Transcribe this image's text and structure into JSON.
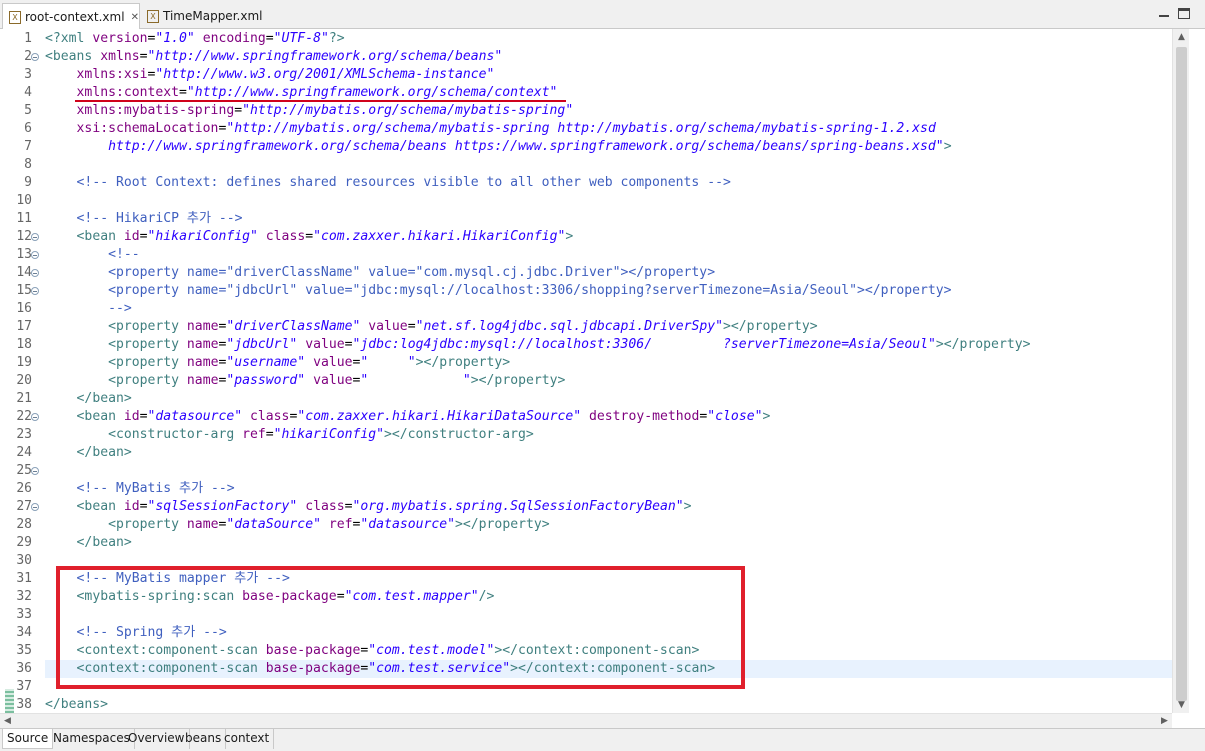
{
  "tabs": [
    {
      "label": "root-context.xml",
      "icon": "xml-file-icon",
      "active": true
    },
    {
      "label": "TimeMapper.xml",
      "icon": "xml-file-icon",
      "active": false
    }
  ],
  "lines": [
    [
      [
        "t",
        "<?xml "
      ],
      [
        "a",
        "version"
      ],
      [
        "",
        "="
      ],
      [
        "v",
        "\"1.0\""
      ],
      [
        "a",
        " encoding"
      ],
      [
        "",
        "="
      ],
      [
        "v",
        "\"UTF-8\""
      ],
      [
        "t",
        "?>"
      ]
    ],
    [
      [
        "t",
        "<beans "
      ],
      [
        "a",
        "xmlns"
      ],
      [
        "",
        "="
      ],
      [
        "v",
        "\"http://www.springframework.org/schema/beans\""
      ]
    ],
    [
      [
        "",
        "    "
      ],
      [
        "a",
        "xmlns:xsi"
      ],
      [
        "",
        "="
      ],
      [
        "v",
        "\"http://www.w3.org/2001/XMLSchema-instance\""
      ]
    ],
    [
      [
        "",
        "    "
      ],
      [
        "a",
        "xmlns:context"
      ],
      [
        "",
        "="
      ],
      [
        "v",
        "\"http://www.springframework.org/schema/context\""
      ]
    ],
    [
      [
        "",
        "    "
      ],
      [
        "a",
        "xmlns:mybatis-spring"
      ],
      [
        "",
        "="
      ],
      [
        "v",
        "\"http://mybatis.org/schema/mybatis-spring\""
      ]
    ],
    [
      [
        "",
        "    "
      ],
      [
        "a",
        "xsi:schemaLocation"
      ],
      [
        "",
        "="
      ],
      [
        "v",
        "\"http://mybatis.org/schema/mybatis-spring http://mybatis.org/schema/mybatis-spring-1.2.xsd"
      ]
    ],
    [
      [
        "v",
        "        http://www.springframework.org/schema/beans https://www.springframework.org/schema/beans/spring-beans.xsd\""
      ],
      [
        "t",
        ">"
      ]
    ],
    [],
    [
      [
        "",
        "    "
      ],
      [
        "c",
        "<!-- Root Context: defines shared resources visible to all other web components -->"
      ]
    ],
    [],
    [
      [
        "",
        "    "
      ],
      [
        "c",
        "<!-- HikariCP 추가 -->"
      ]
    ],
    [
      [
        "",
        "    "
      ],
      [
        "t",
        "<bean "
      ],
      [
        "a",
        "id"
      ],
      [
        "",
        "="
      ],
      [
        "v",
        "\"hikariConfig\""
      ],
      [
        "a",
        " class"
      ],
      [
        "",
        "="
      ],
      [
        "v",
        "\"com.zaxxer.hikari.HikariConfig\""
      ],
      [
        "t",
        ">"
      ]
    ],
    [
      [
        "",
        "        "
      ],
      [
        "c",
        "<!--"
      ]
    ],
    [
      [
        "",
        "        "
      ],
      [
        "c",
        "<property name=\"driverClassName\" value=\"com.mysql.cj.jdbc.Driver\"></property>"
      ]
    ],
    [
      [
        "",
        "        "
      ],
      [
        "c",
        "<property name=\"jdbcUrl\" value=\"jdbc:mysql://localhost:3306/shopping?serverTimezone=Asia/Seoul\"></property>"
      ]
    ],
    [
      [
        "",
        "        "
      ],
      [
        "c",
        "-->"
      ]
    ],
    [
      [
        "",
        "        "
      ],
      [
        "t",
        "<property "
      ],
      [
        "a",
        "name"
      ],
      [
        "",
        "="
      ],
      [
        "v",
        "\"driverClassName\""
      ],
      [
        "a",
        " value"
      ],
      [
        "",
        "="
      ],
      [
        "v",
        "\"net.sf.log4jdbc.sql.jdbcapi.DriverSpy\""
      ],
      [
        "t",
        "></property>"
      ]
    ],
    [
      [
        "",
        "        "
      ],
      [
        "t",
        "<property "
      ],
      [
        "a",
        "name"
      ],
      [
        "",
        "="
      ],
      [
        "v",
        "\"jdbcUrl\""
      ],
      [
        "a",
        " value"
      ],
      [
        "",
        "="
      ],
      [
        "v",
        "\"jdbc:log4jdbc:mysql://localhost:3306/         ?serverTimezone=Asia/Seoul\""
      ],
      [
        "t",
        "></property>"
      ]
    ],
    [
      [
        "",
        "        "
      ],
      [
        "t",
        "<property "
      ],
      [
        "a",
        "name"
      ],
      [
        "",
        "="
      ],
      [
        "v",
        "\"username\""
      ],
      [
        "a",
        " value"
      ],
      [
        "",
        "="
      ],
      [
        "v",
        "\"     \""
      ],
      [
        "t",
        "></property>"
      ]
    ],
    [
      [
        "",
        "        "
      ],
      [
        "t",
        "<property "
      ],
      [
        "a",
        "name"
      ],
      [
        "",
        "="
      ],
      [
        "v",
        "\"password\""
      ],
      [
        "a",
        " value"
      ],
      [
        "",
        "="
      ],
      [
        "v",
        "\"            \""
      ],
      [
        "t",
        "></property>"
      ]
    ],
    [
      [
        "",
        "    "
      ],
      [
        "t",
        "</bean>"
      ]
    ],
    [
      [
        "",
        "    "
      ],
      [
        "t",
        "<bean "
      ],
      [
        "a",
        "id"
      ],
      [
        "",
        "="
      ],
      [
        "v",
        "\"datasource\""
      ],
      [
        "a",
        " class"
      ],
      [
        "",
        "="
      ],
      [
        "v",
        "\"com.zaxxer.hikari.HikariDataSource\""
      ],
      [
        "a",
        " destroy-method"
      ],
      [
        "",
        "="
      ],
      [
        "v",
        "\"close\""
      ],
      [
        "t",
        ">"
      ]
    ],
    [
      [
        "",
        "        "
      ],
      [
        "t",
        "<constructor-arg "
      ],
      [
        "a",
        "ref"
      ],
      [
        "",
        "="
      ],
      [
        "v",
        "\"hikariConfig\""
      ],
      [
        "t",
        "></constructor-arg>"
      ]
    ],
    [
      [
        "",
        "    "
      ],
      [
        "t",
        "</bean>"
      ]
    ],
    [],
    [
      [
        "",
        "    "
      ],
      [
        "c",
        "<!-- MyBatis 추가 -->"
      ]
    ],
    [
      [
        "",
        "    "
      ],
      [
        "t",
        "<bean "
      ],
      [
        "a",
        "id"
      ],
      [
        "",
        "="
      ],
      [
        "v",
        "\"sqlSessionFactory\""
      ],
      [
        "a",
        " class"
      ],
      [
        "",
        "="
      ],
      [
        "v",
        "\"org.mybatis.spring.SqlSessionFactoryBean\""
      ],
      [
        "t",
        ">"
      ]
    ],
    [
      [
        "",
        "        "
      ],
      [
        "t",
        "<property "
      ],
      [
        "a",
        "name"
      ],
      [
        "",
        "="
      ],
      [
        "v",
        "\"dataSource\""
      ],
      [
        "a",
        " ref"
      ],
      [
        "",
        "="
      ],
      [
        "v",
        "\"datasource\""
      ],
      [
        "t",
        "></property>"
      ]
    ],
    [
      [
        "",
        "    "
      ],
      [
        "t",
        "</bean>"
      ]
    ],
    [],
    [
      [
        "",
        "    "
      ],
      [
        "c",
        "<!-- MyBatis mapper 추가 -->"
      ]
    ],
    [
      [
        "",
        "    "
      ],
      [
        "t",
        "<mybatis-spring:scan "
      ],
      [
        "a",
        "base-package"
      ],
      [
        "",
        "="
      ],
      [
        "v",
        "\"com.test.mapper\""
      ],
      [
        "t",
        "/>"
      ]
    ],
    [],
    [
      [
        "",
        "    "
      ],
      [
        "c",
        "<!-- Spring 추가 -->"
      ]
    ],
    [
      [
        "",
        "    "
      ],
      [
        "t",
        "<context:component-scan "
      ],
      [
        "a",
        "base-package"
      ],
      [
        "",
        "="
      ],
      [
        "v",
        "\"com.test.model\""
      ],
      [
        "t",
        "></context:component-scan>"
      ]
    ],
    [
      [
        "",
        "    "
      ],
      [
        "t",
        "<context:component-scan "
      ],
      [
        "a",
        "base-package"
      ],
      [
        "",
        "="
      ],
      [
        "v",
        "\"com.test.service\""
      ],
      [
        "t",
        "></context:component-scan>"
      ]
    ],
    [],
    [
      [
        "t",
        "</beans>"
      ]
    ]
  ],
  "fold_lines": [
    2,
    12,
    13,
    14,
    15,
    22,
    25,
    27
  ],
  "current_line": 36,
  "bottom_tabs": [
    "Source",
    "Namespaces",
    "Overview",
    "beans",
    "context"
  ],
  "active_bottom_tab": "Source",
  "colors": {
    "tag": "#3f7f7f",
    "attribute": "#7f007f",
    "value": "#2a00ff",
    "comment": "#3f5fbf",
    "highlight": "#e0202c"
  }
}
